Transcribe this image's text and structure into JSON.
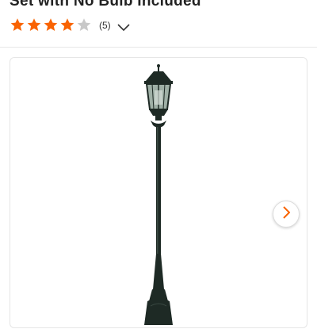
{
  "product": {
    "title_fragment": "Set with No Bulb Included",
    "rating": {
      "value": 4,
      "max": 5,
      "count_text": "(5)",
      "filled_color": "#f96302",
      "empty_color": "#c8c8c8"
    }
  },
  "gallery": {
    "image_name": "lamp-post-image",
    "next_icon": "chevron-right-icon",
    "accent": "#f96302"
  }
}
